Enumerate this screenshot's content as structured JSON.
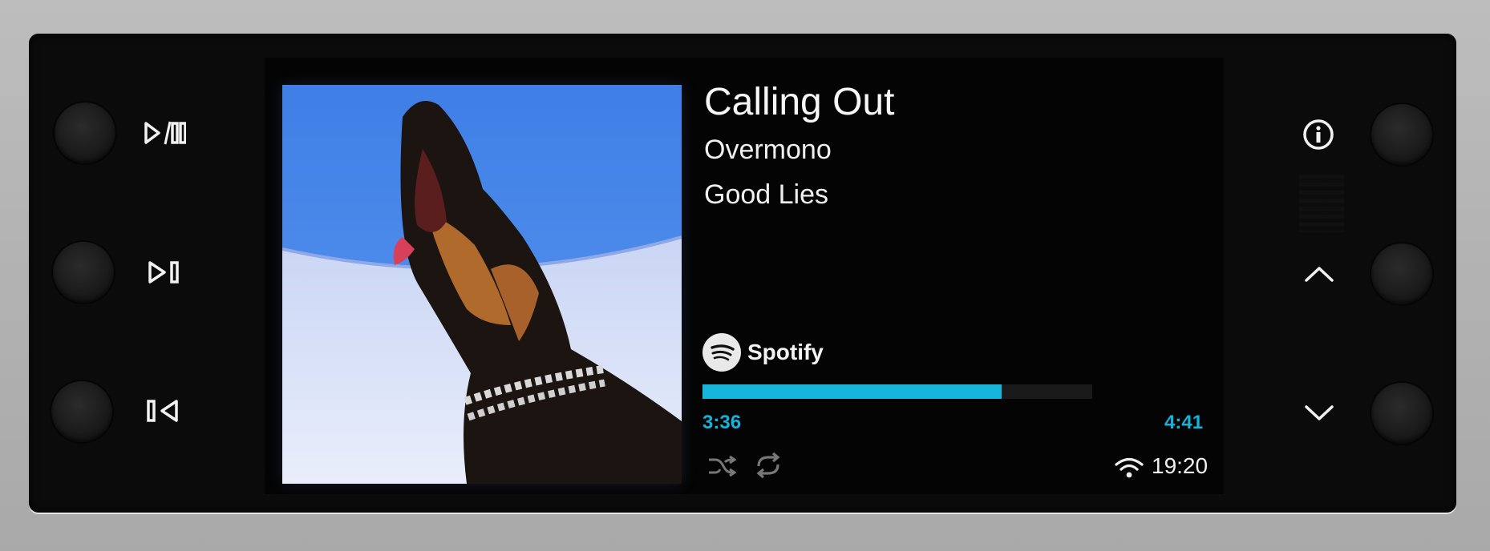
{
  "track": {
    "title": "Calling Out",
    "artist": "Overmono",
    "album": "Good Lies"
  },
  "source": {
    "label": "Spotify"
  },
  "playback": {
    "elapsed": "3:36",
    "total": "4:41",
    "progress_fraction": 0.768
  },
  "status": {
    "clock": "19:20"
  },
  "colors": {
    "accent": "#16b6dc",
    "background": "#040404"
  },
  "icons": {
    "left": [
      "play-pause-icon",
      "next-track-icon",
      "previous-track-icon"
    ],
    "right": [
      "info-icon",
      "chevron-up-icon",
      "chevron-down-icon"
    ],
    "bottom": [
      "shuffle-icon",
      "repeat-icon",
      "wifi-icon"
    ]
  }
}
